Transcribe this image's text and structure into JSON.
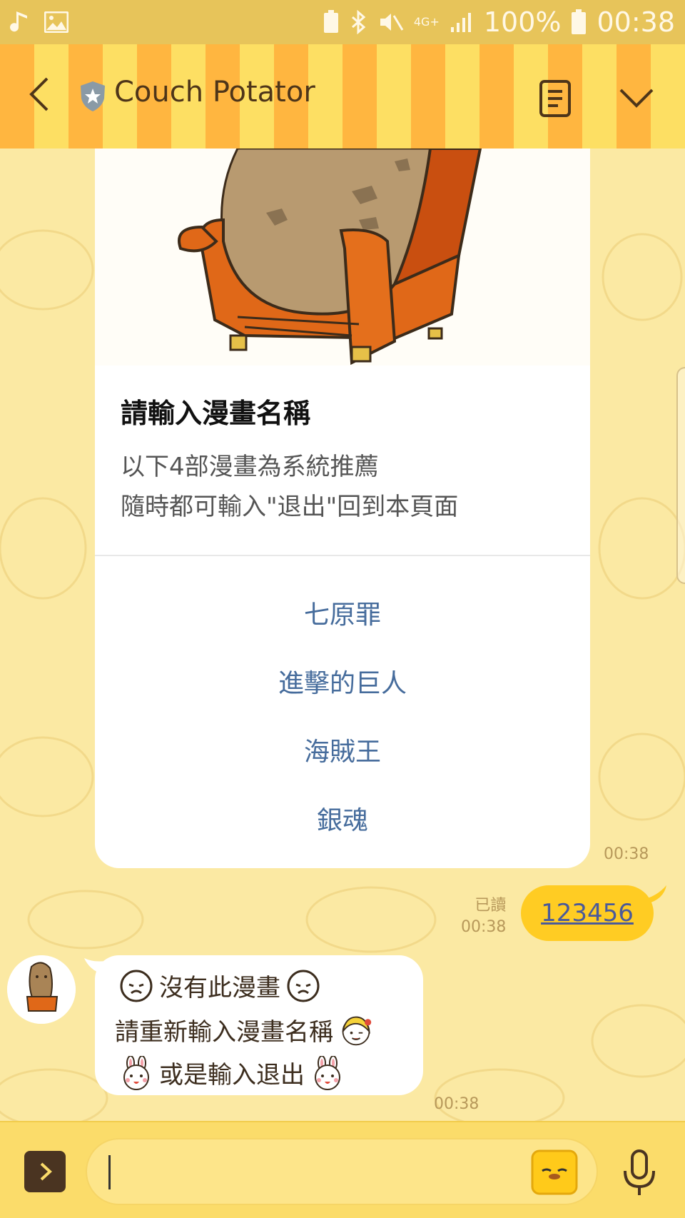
{
  "status_bar": {
    "network": "4G+",
    "battery": "100%",
    "time": "00:38"
  },
  "header": {
    "title": "Couch Potator",
    "back_icon": "chevron-left-icon",
    "account_icon": "shield-star-icon",
    "note_icon": "note-icon",
    "menu_icon": "chevron-down-icon"
  },
  "card": {
    "title": "請輸入漫畫名稱",
    "desc_line1": "以下4部漫畫為系統推薦",
    "desc_line2": "隨時都可輸入\"退出\"回到本頁面",
    "actions": [
      "七原罪",
      "進擊的巨人",
      "海賊王",
      "銀魂"
    ],
    "time": "00:38"
  },
  "sent_message": {
    "read_label": "已讀",
    "time": "00:38",
    "text": "123456"
  },
  "received_message": {
    "line1": "沒有此漫畫",
    "line2": "請重新輸入漫畫名稱",
    "line3": "或是輸入退出",
    "time": "00:38"
  },
  "input_bar": {
    "value": "",
    "expand_icon": "chevron-right-icon",
    "sticker_icon": "sticker-icon",
    "mic_icon": "mic-icon"
  },
  "colors": {
    "status_bar": "#e7c45a",
    "header_stripe_a": "#ffb640",
    "header_stripe_b": "#fddf63",
    "chat_bg": "#fbe9a3",
    "sent_bubble": "#ffcc23",
    "action_text": "#466c9c"
  }
}
